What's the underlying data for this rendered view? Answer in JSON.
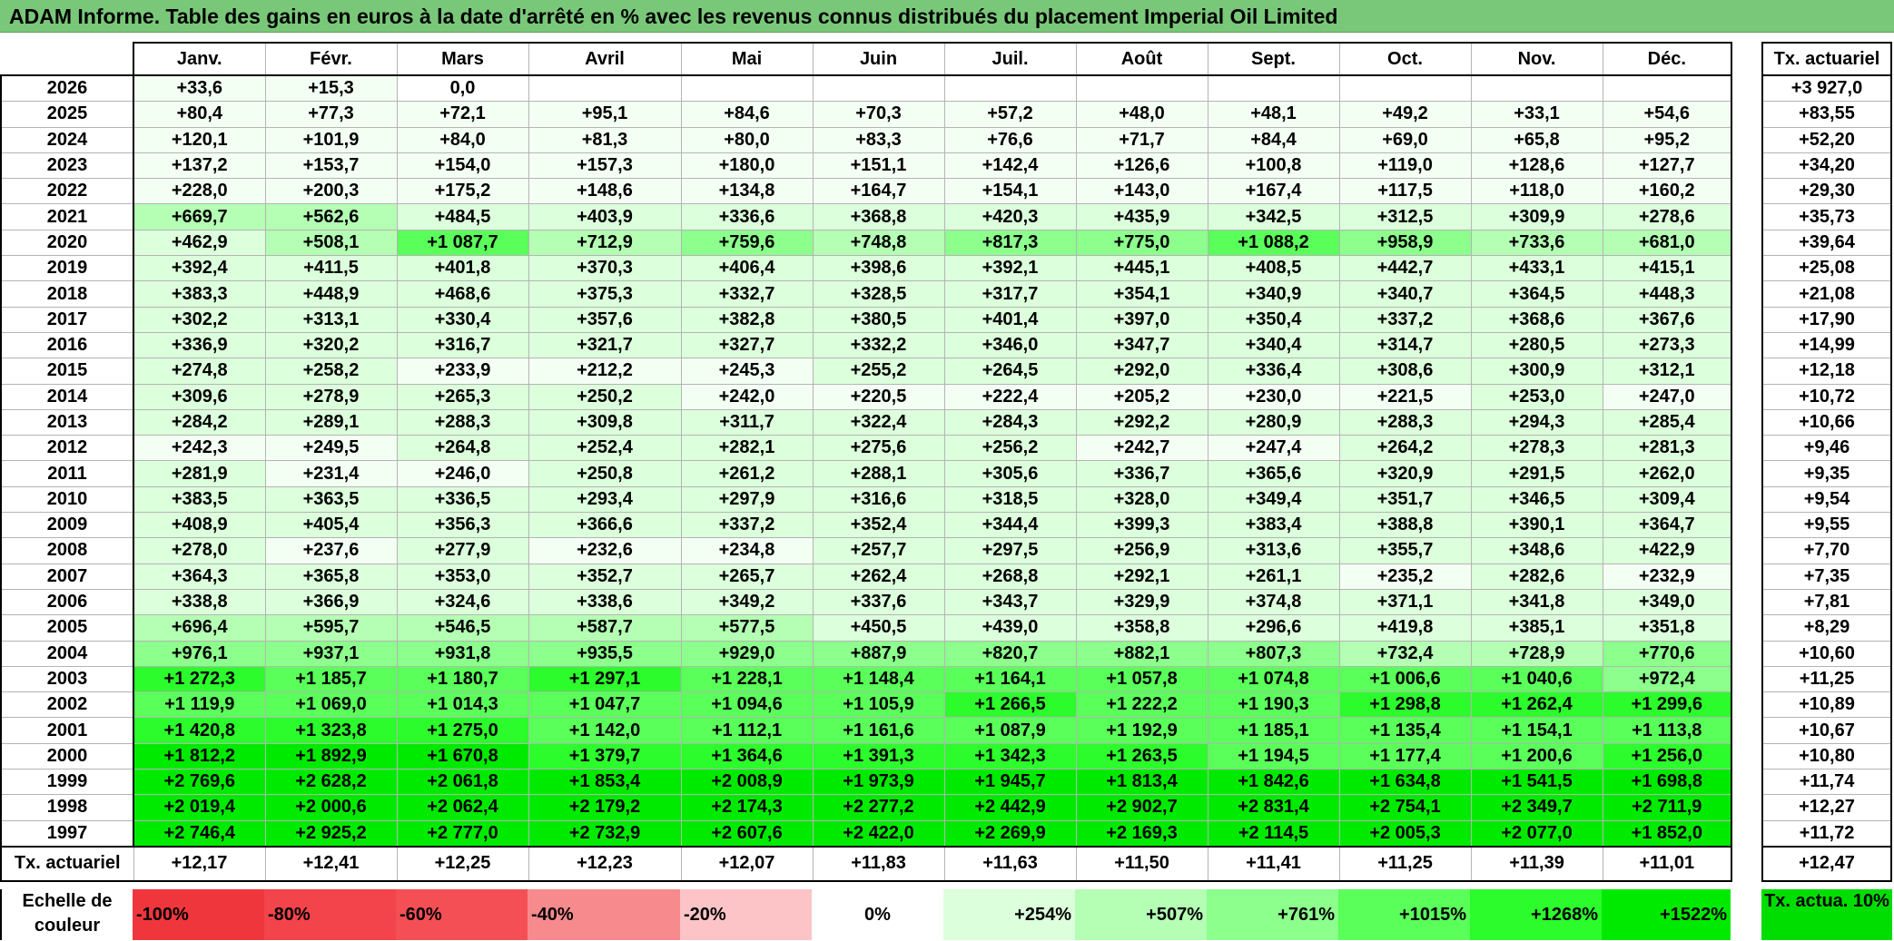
{
  "title": "ADAM Informe. Table des gains en euros à la date d'arrêté en % avec les revenus connus distribués du placement Imperial Oil Limited",
  "months": [
    "Janv.",
    "Févr.",
    "Mars",
    "Avril",
    "Mai",
    "Juin",
    "Juil.",
    "Août",
    "Sept.",
    "Oct.",
    "Nov.",
    "Déc."
  ],
  "side_header": "Tx. actuariel",
  "rows": [
    {
      "year": "2026",
      "cells": [
        "+33,6",
        "+15,3",
        "0,0",
        "",
        "",
        "",
        "",
        "",
        "",
        "",
        "",
        ""
      ],
      "tx": "+3 927,0"
    },
    {
      "year": "2025",
      "cells": [
        "+80,4",
        "+77,3",
        "+72,1",
        "+95,1",
        "+84,6",
        "+70,3",
        "+57,2",
        "+48,0",
        "+48,1",
        "+49,2",
        "+33,1",
        "+54,6"
      ],
      "tx": "+83,55"
    },
    {
      "year": "2024",
      "cells": [
        "+120,1",
        "+101,9",
        "+84,0",
        "+81,3",
        "+80,0",
        "+83,3",
        "+76,6",
        "+71,7",
        "+84,4",
        "+69,0",
        "+65,8",
        "+95,2"
      ],
      "tx": "+52,20"
    },
    {
      "year": "2023",
      "cells": [
        "+137,2",
        "+153,7",
        "+154,0",
        "+157,3",
        "+180,0",
        "+151,1",
        "+142,4",
        "+126,6",
        "+100,8",
        "+119,0",
        "+128,6",
        "+127,7"
      ],
      "tx": "+34,20"
    },
    {
      "year": "2022",
      "cells": [
        "+228,0",
        "+200,3",
        "+175,2",
        "+148,6",
        "+134,8",
        "+164,7",
        "+154,1",
        "+143,0",
        "+167,4",
        "+117,5",
        "+118,0",
        "+160,2"
      ],
      "tx": "+29,30"
    },
    {
      "year": "2021",
      "cells": [
        "+669,7",
        "+562,6",
        "+484,5",
        "+403,9",
        "+336,6",
        "+368,8",
        "+420,3",
        "+435,9",
        "+342,5",
        "+312,5",
        "+309,9",
        "+278,6"
      ],
      "tx": "+35,73"
    },
    {
      "year": "2020",
      "cells": [
        "+462,9",
        "+508,1",
        "+1 087,7",
        "+712,9",
        "+759,6",
        "+748,8",
        "+817,3",
        "+775,0",
        "+1 088,2",
        "+958,9",
        "+733,6",
        "+681,0"
      ],
      "tx": "+39,64"
    },
    {
      "year": "2019",
      "cells": [
        "+392,4",
        "+411,5",
        "+401,8",
        "+370,3",
        "+406,4",
        "+398,6",
        "+392,1",
        "+445,1",
        "+408,5",
        "+442,7",
        "+433,1",
        "+415,1"
      ],
      "tx": "+25,08"
    },
    {
      "year": "2018",
      "cells": [
        "+383,3",
        "+448,9",
        "+468,6",
        "+375,3",
        "+332,7",
        "+328,5",
        "+317,7",
        "+354,1",
        "+340,9",
        "+340,7",
        "+364,5",
        "+448,3"
      ],
      "tx": "+21,08"
    },
    {
      "year": "2017",
      "cells": [
        "+302,2",
        "+313,1",
        "+330,4",
        "+357,6",
        "+382,8",
        "+380,5",
        "+401,4",
        "+397,0",
        "+350,4",
        "+337,2",
        "+368,6",
        "+367,6"
      ],
      "tx": "+17,90"
    },
    {
      "year": "2016",
      "cells": [
        "+336,9",
        "+320,2",
        "+316,7",
        "+321,7",
        "+327,7",
        "+332,2",
        "+346,0",
        "+347,7",
        "+340,4",
        "+314,7",
        "+280,5",
        "+273,3"
      ],
      "tx": "+14,99"
    },
    {
      "year": "2015",
      "cells": [
        "+274,8",
        "+258,2",
        "+233,9",
        "+212,2",
        "+245,3",
        "+255,2",
        "+264,5",
        "+292,0",
        "+336,4",
        "+308,6",
        "+300,9",
        "+312,1"
      ],
      "tx": "+12,18"
    },
    {
      "year": "2014",
      "cells": [
        "+309,6",
        "+278,9",
        "+265,3",
        "+250,2",
        "+242,0",
        "+220,5",
        "+222,4",
        "+205,2",
        "+230,0",
        "+221,5",
        "+253,0",
        "+247,0"
      ],
      "tx": "+10,72"
    },
    {
      "year": "2013",
      "cells": [
        "+284,2",
        "+289,1",
        "+288,3",
        "+309,8",
        "+311,7",
        "+322,4",
        "+284,3",
        "+292,2",
        "+280,9",
        "+288,3",
        "+294,3",
        "+285,4"
      ],
      "tx": "+10,66"
    },
    {
      "year": "2012",
      "cells": [
        "+242,3",
        "+249,5",
        "+264,8",
        "+252,4",
        "+282,1",
        "+275,6",
        "+256,2",
        "+242,7",
        "+247,4",
        "+264,2",
        "+278,3",
        "+281,3"
      ],
      "tx": "+9,46"
    },
    {
      "year": "2011",
      "cells": [
        "+281,9",
        "+231,4",
        "+246,0",
        "+250,8",
        "+261,2",
        "+288,1",
        "+305,6",
        "+336,7",
        "+365,6",
        "+320,9",
        "+291,5",
        "+262,0"
      ],
      "tx": "+9,35"
    },
    {
      "year": "2010",
      "cells": [
        "+383,5",
        "+363,5",
        "+336,5",
        "+293,4",
        "+297,9",
        "+316,6",
        "+318,5",
        "+328,0",
        "+349,4",
        "+351,7",
        "+346,5",
        "+309,4"
      ],
      "tx": "+9,54"
    },
    {
      "year": "2009",
      "cells": [
        "+408,9",
        "+405,4",
        "+356,3",
        "+366,6",
        "+337,2",
        "+352,4",
        "+344,4",
        "+399,3",
        "+383,4",
        "+388,8",
        "+390,1",
        "+364,7"
      ],
      "tx": "+9,55"
    },
    {
      "year": "2008",
      "cells": [
        "+278,0",
        "+237,6",
        "+277,9",
        "+232,6",
        "+234,8",
        "+257,7",
        "+297,5",
        "+256,9",
        "+313,6",
        "+355,7",
        "+348,6",
        "+422,9"
      ],
      "tx": "+7,70"
    },
    {
      "year": "2007",
      "cells": [
        "+364,3",
        "+365,8",
        "+353,0",
        "+352,7",
        "+265,7",
        "+262,4",
        "+268,8",
        "+292,1",
        "+261,1",
        "+235,2",
        "+282,6",
        "+232,9"
      ],
      "tx": "+7,35"
    },
    {
      "year": "2006",
      "cells": [
        "+338,8",
        "+366,9",
        "+324,6",
        "+338,6",
        "+349,2",
        "+337,6",
        "+343,7",
        "+329,9",
        "+374,8",
        "+371,1",
        "+341,8",
        "+349,0"
      ],
      "tx": "+7,81"
    },
    {
      "year": "2005",
      "cells": [
        "+696,4",
        "+595,7",
        "+546,5",
        "+587,7",
        "+577,5",
        "+450,5",
        "+439,0",
        "+358,8",
        "+296,6",
        "+419,8",
        "+385,1",
        "+351,8"
      ],
      "tx": "+8,29"
    },
    {
      "year": "2004",
      "cells": [
        "+976,1",
        "+937,1",
        "+931,8",
        "+935,5",
        "+929,0",
        "+887,9",
        "+820,7",
        "+882,1",
        "+807,3",
        "+732,4",
        "+728,9",
        "+770,6"
      ],
      "tx": "+10,60"
    },
    {
      "year": "2003",
      "cells": [
        "+1 272,3",
        "+1 185,7",
        "+1 180,7",
        "+1 297,1",
        "+1 228,1",
        "+1 148,4",
        "+1 164,1",
        "+1 057,8",
        "+1 074,8",
        "+1 006,6",
        "+1 040,6",
        "+972,4"
      ],
      "tx": "+11,25"
    },
    {
      "year": "2002",
      "cells": [
        "+1 119,9",
        "+1 069,0",
        "+1 014,3",
        "+1 047,7",
        "+1 094,6",
        "+1 105,9",
        "+1 266,5",
        "+1 222,2",
        "+1 190,3",
        "+1 298,8",
        "+1 262,4",
        "+1 299,6"
      ],
      "tx": "+10,89"
    },
    {
      "year": "2001",
      "cells": [
        "+1 420,8",
        "+1 323,8",
        "+1 275,0",
        "+1 142,0",
        "+1 112,1",
        "+1 161,6",
        "+1 087,9",
        "+1 192,9",
        "+1 185,1",
        "+1 135,4",
        "+1 154,1",
        "+1 113,8"
      ],
      "tx": "+10,67"
    },
    {
      "year": "2000",
      "cells": [
        "+1 812,2",
        "+1 892,9",
        "+1 670,8",
        "+1 379,7",
        "+1 364,6",
        "+1 391,3",
        "+1 342,3",
        "+1 263,5",
        "+1 194,5",
        "+1 177,4",
        "+1 200,6",
        "+1 256,0"
      ],
      "tx": "+10,80"
    },
    {
      "year": "1999",
      "cells": [
        "+2 769,6",
        "+2 628,2",
        "+2 061,8",
        "+1 853,4",
        "+2 008,9",
        "+1 973,9",
        "+1 945,7",
        "+1 813,4",
        "+1 842,6",
        "+1 634,8",
        "+1 541,5",
        "+1 698,8"
      ],
      "tx": "+11,74"
    },
    {
      "year": "1998",
      "cells": [
        "+2 019,4",
        "+2 000,6",
        "+2 062,4",
        "+2 179,2",
        "+2 174,3",
        "+2 277,2",
        "+2 442,9",
        "+2 902,7",
        "+2 831,4",
        "+2 754,1",
        "+2 349,7",
        "+2 711,9"
      ],
      "tx": "+12,27"
    },
    {
      "year": "1997",
      "cells": [
        "+2 746,4",
        "+2 925,2",
        "+2 777,0",
        "+2 732,9",
        "+2 607,6",
        "+2 422,0",
        "+2 269,9",
        "+2 169,3",
        "+2 114,5",
        "+2 005,3",
        "+2 077,0",
        "+1 852,0"
      ],
      "tx": "+11,72"
    }
  ],
  "summary": {
    "label": "Tx. actuariel",
    "values": [
      "+12,17",
      "+12,41",
      "+12,25",
      "+12,23",
      "+12,07",
      "+11,83",
      "+11,63",
      "+11,50",
      "+11,41",
      "+11,25",
      "+11,39",
      "+11,01"
    ],
    "total": "+12,47"
  },
  "scale": {
    "label": "Echelle de couleur",
    "items": [
      {
        "text": "-100%",
        "color": "#f0363d",
        "kind": "neg"
      },
      {
        "text": "-80%",
        "color": "#f2444a",
        "kind": "neg"
      },
      {
        "text": "-60%",
        "color": "#f44f55",
        "kind": "neg"
      },
      {
        "text": "-40%",
        "color": "#f78a8c",
        "kind": "neg"
      },
      {
        "text": "-20%",
        "color": "#fcc4c6",
        "kind": "neg"
      },
      {
        "text": "0%",
        "color": "#ffffff",
        "kind": "zero"
      },
      {
        "text": "+254%",
        "color": "#dcffdc",
        "kind": "pos"
      },
      {
        "text": "+507%",
        "color": "#b4ffb4",
        "kind": "pos"
      },
      {
        "text": "+761%",
        "color": "#8cff8c",
        "kind": "pos"
      },
      {
        "text": "+1015%",
        "color": "#5aff5a",
        "kind": "pos"
      },
      {
        "text": "+1268%",
        "color": "#2cfc2c",
        "kind": "pos"
      },
      {
        "text": "+1522%",
        "color": "#00ea00",
        "kind": "pos"
      }
    ],
    "tx_box": "Tx. actua. 10%",
    "tx_box_color": "#00dd00"
  }
}
